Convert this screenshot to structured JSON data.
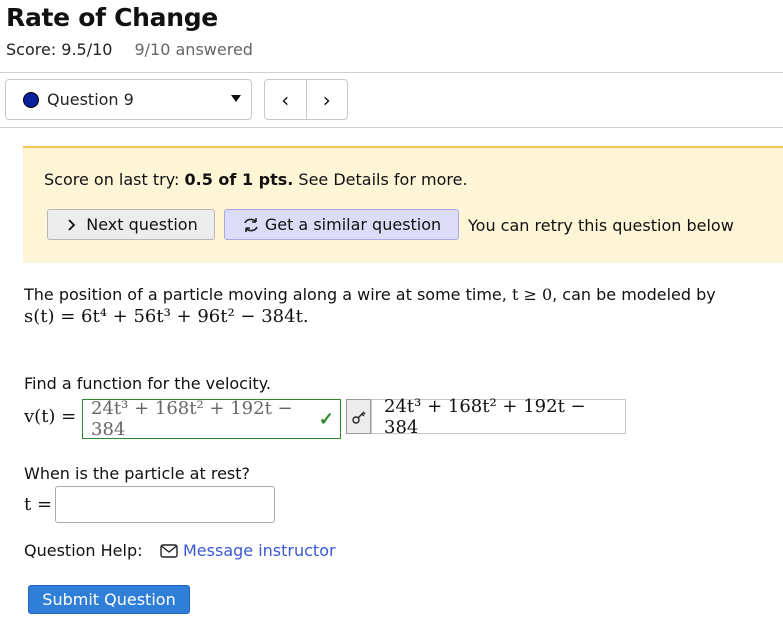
{
  "page": {
    "title": "Rate of Change",
    "score": "Score: 9.5/10",
    "answered": "9/10 answered"
  },
  "nav": {
    "question_select": "Question 9",
    "prev_glyph": "‹",
    "next_glyph": "›"
  },
  "notice": {
    "score_prefix": "Score on last try: ",
    "score_value": "0.5 of 1 pts.",
    "score_suffix": " See Details for more.",
    "next_button": "Next question",
    "similar_button": "Get a similar question",
    "retry_text": "You can retry this question below"
  },
  "problem": {
    "text": "The position of a particle moving along a wire at some time, ",
    "t_condition": "t ≥ 0",
    "text_suffix": ", can be modeled by",
    "position_function": "s(t) = 6t⁴ + 56t³ + 96t² − 384t."
  },
  "part1": {
    "label": "Find a function for the velocity.",
    "var_label": "v(t) =",
    "answer": "24t³ + 168t² + 192t − 384",
    "correct_answer": "24t³ + 168t² + 192t − 384"
  },
  "part2": {
    "label": "When is the particle at rest?",
    "var_label": "t =",
    "value": "",
    "placeholder": ""
  },
  "help": {
    "label": "Question Help:",
    "link": "Message instructor"
  },
  "submit": {
    "label": "Submit Question"
  },
  "colors": {
    "status_dot": "#0a1f9c",
    "notice_bg": "#fdf5d6",
    "notice_border": "#f2c558",
    "correct": "#2d8a2d",
    "link": "#3a5ad6",
    "submit_bg": "#2f7fd8"
  }
}
